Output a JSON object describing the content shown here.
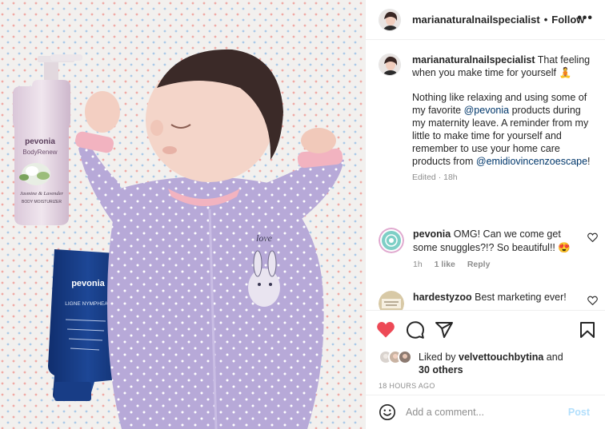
{
  "post": {
    "username": "marianaturalnailspecialist",
    "follow_label": "Follow",
    "dot": "•",
    "more_label": "•••"
  },
  "caption": {
    "username": "marianaturalnailspecialist",
    "line1": "That feeling when you make time for yourself",
    "emoji": "🧘",
    "para2_a": "Nothing like relaxing and using some of my favorite ",
    "mention_pevonia": "@pevonia",
    "para2_b": " products during my maternity leave. A reminder from my little to make time for yourself and remember to use your home care products from ",
    "mention_spa": "@emidiovincenzoescape",
    "para2_c": "!",
    "edited": "Edited · 18h"
  },
  "comments": [
    {
      "username": "pevonia",
      "text": "OMG! Can we come get some snuggles?!? So beautiful!! 😍",
      "age": "1h",
      "likes": "1 like",
      "reply": "Reply"
    },
    {
      "username": "hardestyzoo",
      "text": "Best marketing ever!"
    }
  ],
  "likes": {
    "prefix": "Liked by ",
    "user": "velvettouchbytina",
    "joiner": " and",
    "others": "30 others"
  },
  "timestamp": "18 HOURS AGO",
  "add_comment": {
    "placeholder": "Add a comment...",
    "post_label": "Post"
  },
  "photo": {
    "bottle_brand": "pevonia",
    "bottle_product": "BodyRenew",
    "bottle_variant": "Jasmine & Lavender",
    "bottle_type": "BODY MOISTURIZER",
    "tube_brand": "pevonia",
    "tube_line": "LIGNE NYMPHEA",
    "onesie_text": "love"
  },
  "colors": {
    "accent_red": "#ed4956",
    "link_blue": "#00376b",
    "post_disabled": "#b2dffc",
    "secondary_text": "#8e8e8e"
  }
}
